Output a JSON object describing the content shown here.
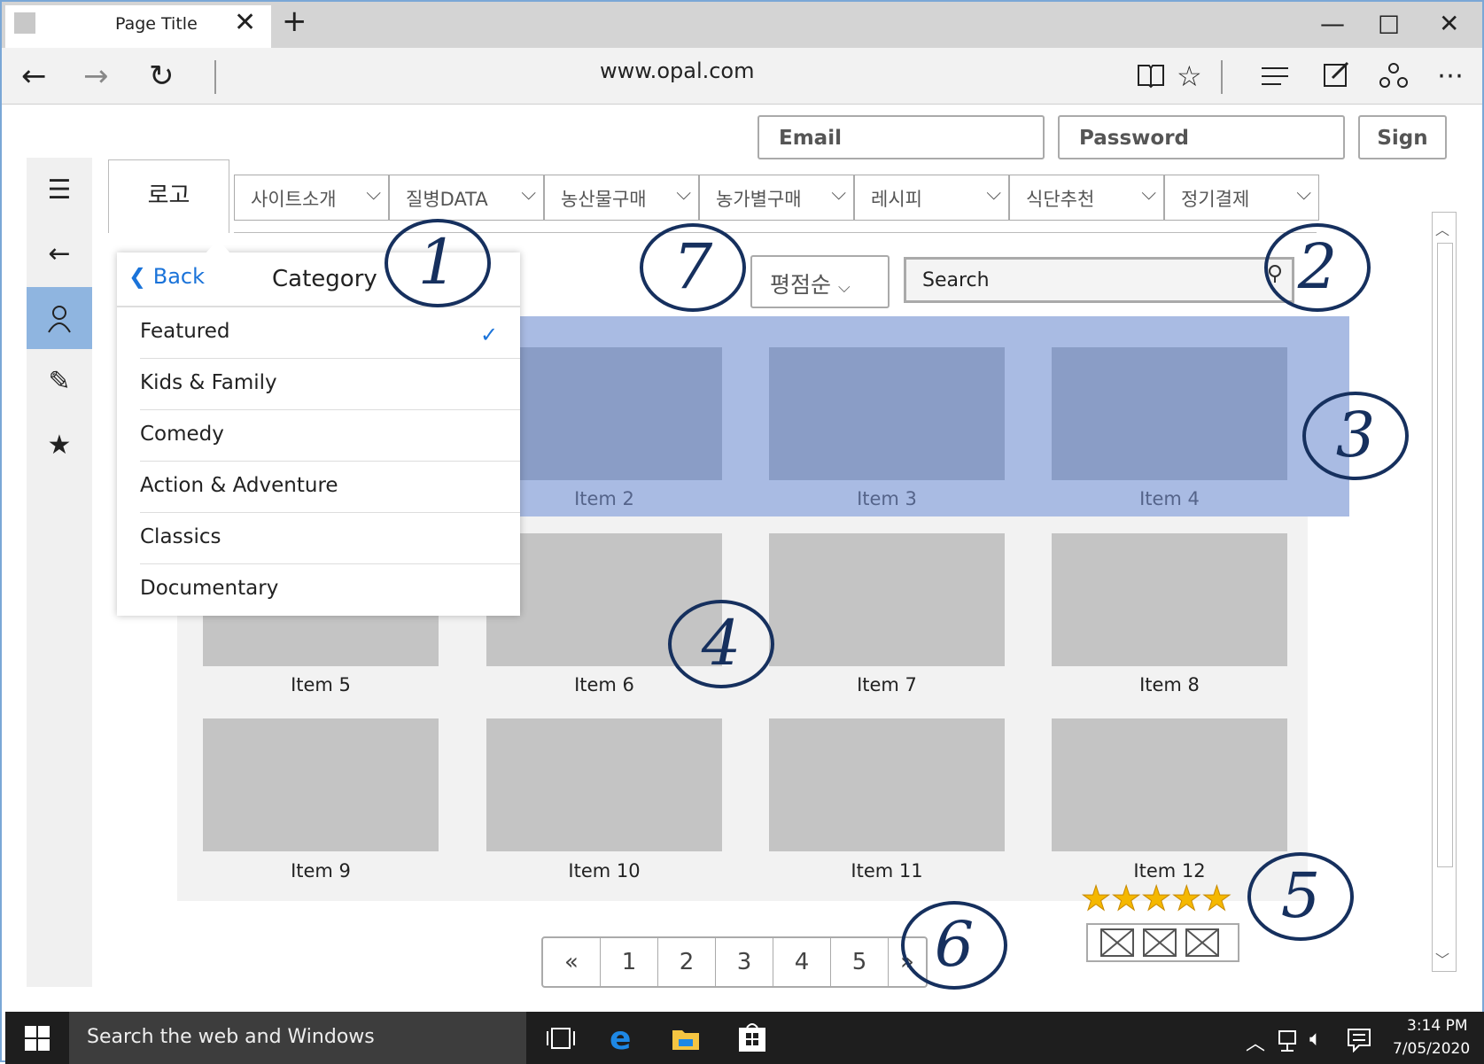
{
  "browser": {
    "tab_title": "Page Title",
    "url": "www.opal.com",
    "new_tab": "+",
    "close_tab": "✕"
  },
  "header": {
    "email_placeholder": "Email",
    "password_placeholder": "Password",
    "sign_label": "Sign"
  },
  "logo": "로고",
  "menu": [
    {
      "label": "사이트소개"
    },
    {
      "label": "질병DATA"
    },
    {
      "label": "농산물구매"
    },
    {
      "label": "농가별구매"
    },
    {
      "label": "레시피"
    },
    {
      "label": "식단추천"
    },
    {
      "label": "정기결제"
    }
  ],
  "sort": {
    "label": "평점순"
  },
  "search": {
    "placeholder": "Search"
  },
  "category": {
    "back_label": "Back",
    "title": "Category",
    "items": [
      "Featured",
      "Kids & Family",
      "Comedy",
      "Action & Adventure",
      "Classics",
      "Documentary"
    ],
    "selected": "Featured"
  },
  "items": [
    "Item 2",
    "Item 3",
    "Item 4",
    "Item 5",
    "Item 6",
    "Item 7",
    "Item 8",
    "Item 9",
    "Item 10",
    "Item 11",
    "Item 12"
  ],
  "pagination": {
    "prev": "«",
    "pages": [
      "1",
      "2",
      "3",
      "4",
      "5"
    ],
    "next": "»"
  },
  "rating": {
    "stars": 5,
    "max": 5
  },
  "annotations": [
    "1",
    "2",
    "3",
    "4",
    "5",
    "6",
    "7"
  ],
  "taskbar": {
    "search_text": "Search the web and Windows",
    "time": "3:14 PM",
    "date": "7/05/2020"
  },
  "colors": {
    "selection": "#a9bbe3",
    "selected_thumb": "#8a9dc6",
    "thumb": "#c4c4c4",
    "sidebar_active": "#8fb5e0",
    "accent": "#1a73d9",
    "star": "#f5b800",
    "annotation_ink": "#16305e"
  }
}
